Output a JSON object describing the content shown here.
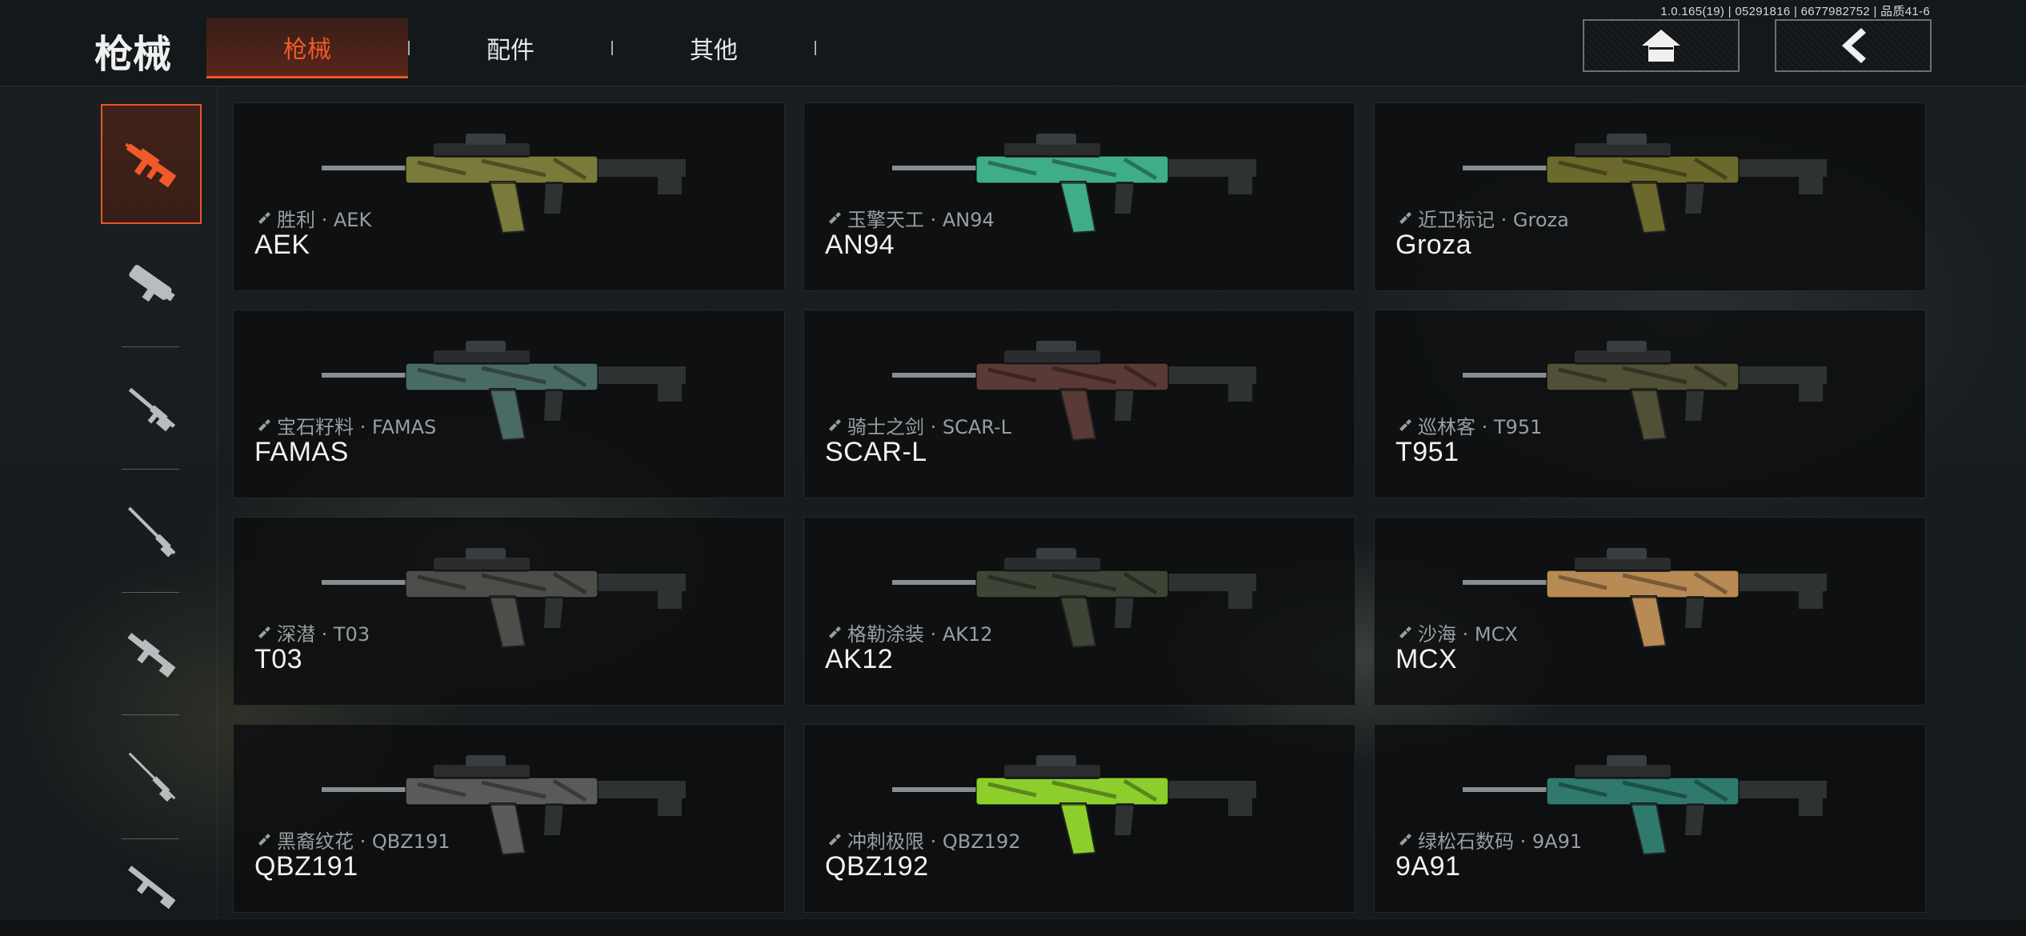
{
  "version": "1.0.165(19) | 05291816 | 6677982752 | 品质41-6",
  "page_title": "枪械",
  "tabs": [
    {
      "label": "枪械",
      "active": true
    },
    {
      "label": "配件",
      "active": false
    },
    {
      "label": "其他",
      "active": false
    }
  ],
  "nav": {
    "home_icon": "home-icon",
    "back_icon": "chevron-left-icon"
  },
  "accent_color": "#f05a2a",
  "categories": [
    {
      "icon": "assault-rifle-icon",
      "active": true
    },
    {
      "icon": "smg-icon",
      "active": false
    },
    {
      "icon": "shotgun-icon",
      "active": false
    },
    {
      "icon": "marksman-rifle-icon",
      "active": false
    },
    {
      "icon": "lmg-icon",
      "active": false
    },
    {
      "icon": "sniper-rifle-icon",
      "active": false
    },
    {
      "icon": "rifle-icon",
      "active": false
    }
  ],
  "weapons": [
    {
      "skin": "胜利 · AEK",
      "name": "AEK",
      "color": "#7a7a3a"
    },
    {
      "skin": "玉擎天工 · AN94",
      "name": "AN94",
      "color": "#3fae86"
    },
    {
      "skin": "近卫标记 · Groza",
      "name": "Groza",
      "color": "#6b6a2c"
    },
    {
      "skin": "宝石籽料 · FAMAS",
      "name": "FAMAS",
      "color": "#4a6a64"
    },
    {
      "skin": "骑士之剑 · SCAR-L",
      "name": "SCAR-L",
      "color": "#5a3a36"
    },
    {
      "skin": "巡林客 · T951",
      "name": "T951",
      "color": "#4f5036"
    },
    {
      "skin": "深潜 · T03",
      "name": "T03",
      "color": "#4c4e4a"
    },
    {
      "skin": "格勒涂装 · AK12",
      "name": "AK12",
      "color": "#3e4536"
    },
    {
      "skin": "沙海 · MCX",
      "name": "MCX",
      "color": "#b88a54"
    },
    {
      "skin": "黑裔纹花 · QBZ191",
      "name": "QBZ191",
      "color": "#5a5a5a"
    },
    {
      "skin": "冲刺极限 · QBZ192",
      "name": "QBZ192",
      "color": "#8ccf2c"
    },
    {
      "skin": "绿松石数码 · 9A91",
      "name": "9A91",
      "color": "#2f7a6c"
    }
  ]
}
